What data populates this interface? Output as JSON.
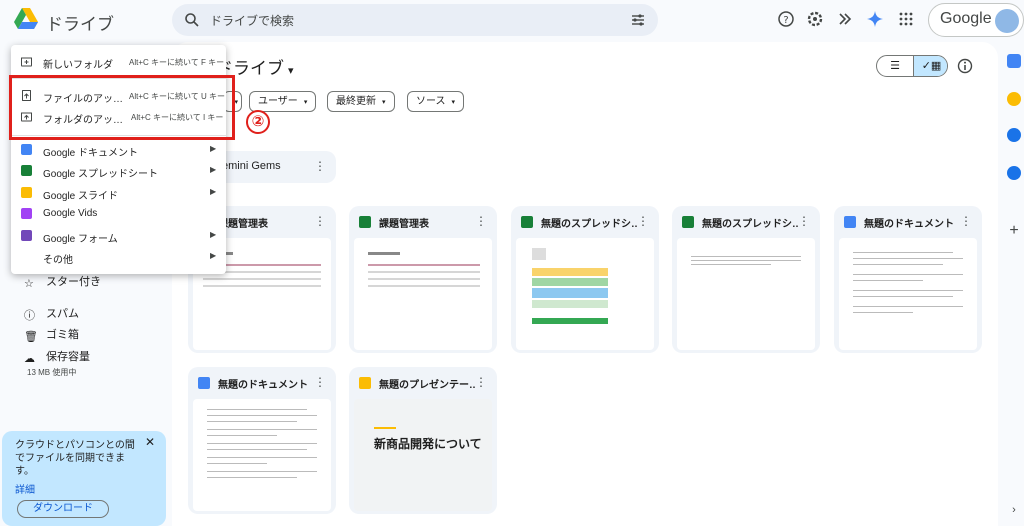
{
  "app": {
    "name": "ドライブ"
  },
  "search": {
    "placeholder": "ドライブで検索"
  },
  "account": {
    "label": "Google"
  },
  "page": {
    "title": "マイドライブ",
    "title_visible": "ドライブ"
  },
  "filters": [
    {
      "label": "ユーザー"
    },
    {
      "label": "最終更新"
    },
    {
      "label": "ソース"
    }
  ],
  "annotation": {
    "step": "②"
  },
  "gem_card": {
    "label": "emini Gems"
  },
  "files": [
    {
      "name": "課題管理表",
      "type": "spreadsheet"
    },
    {
      "name": "課題管理表",
      "type": "spreadsheet"
    },
    {
      "name": "無題のスプレッドシ…",
      "type": "spreadsheet"
    },
    {
      "name": "無題のスプレッドシ…",
      "type": "spreadsheet"
    },
    {
      "name": "無題のドキュメント",
      "type": "document"
    },
    {
      "name": "無題のドキュメント",
      "type": "document"
    },
    {
      "name": "無題のプレゼンテー…",
      "type": "presentation",
      "slide_text": "新商品開発について"
    }
  ],
  "menu": {
    "items": [
      {
        "label": "新しいフォルダ",
        "shortcut": "Alt+C キーに続いて F キー",
        "icon": "new-folder-icon"
      },
      {
        "label": "ファイルのアッ…",
        "shortcut": "Alt+C キーに続いて U キー",
        "icon": "file-upload-icon"
      },
      {
        "label": "フォルダのアッ…",
        "shortcut": "Alt+C キーに続いて I キー",
        "icon": "folder-upload-icon"
      },
      {
        "label": "Google ドキュメント",
        "icon": "docs-icon"
      },
      {
        "label": "Google スプレッドシート",
        "icon": "sheets-icon"
      },
      {
        "label": "Google スライド",
        "icon": "slides-icon"
      },
      {
        "label": "Google Vids",
        "icon": "vids-icon"
      },
      {
        "label": "Google フォーム",
        "icon": "forms-icon"
      },
      {
        "label": "その他"
      }
    ]
  },
  "nav": {
    "starred": "スター付き",
    "spam": "スパム",
    "trash": "ゴミ箱",
    "storage": "保存容量",
    "usage": "13 MB 使用中"
  },
  "promo": {
    "text": "クラウドとパソコンとの間でファイルを同期できます。",
    "link": "詳細",
    "button": "ダウンロード"
  },
  "colors": {
    "accent": "#0b57d0",
    "highlight": "#e0201b",
    "sheets": "#188038",
    "docs": "#4285f4",
    "slides": "#fbbc04",
    "vids": "#a142f4",
    "forms": "#7248b9"
  }
}
